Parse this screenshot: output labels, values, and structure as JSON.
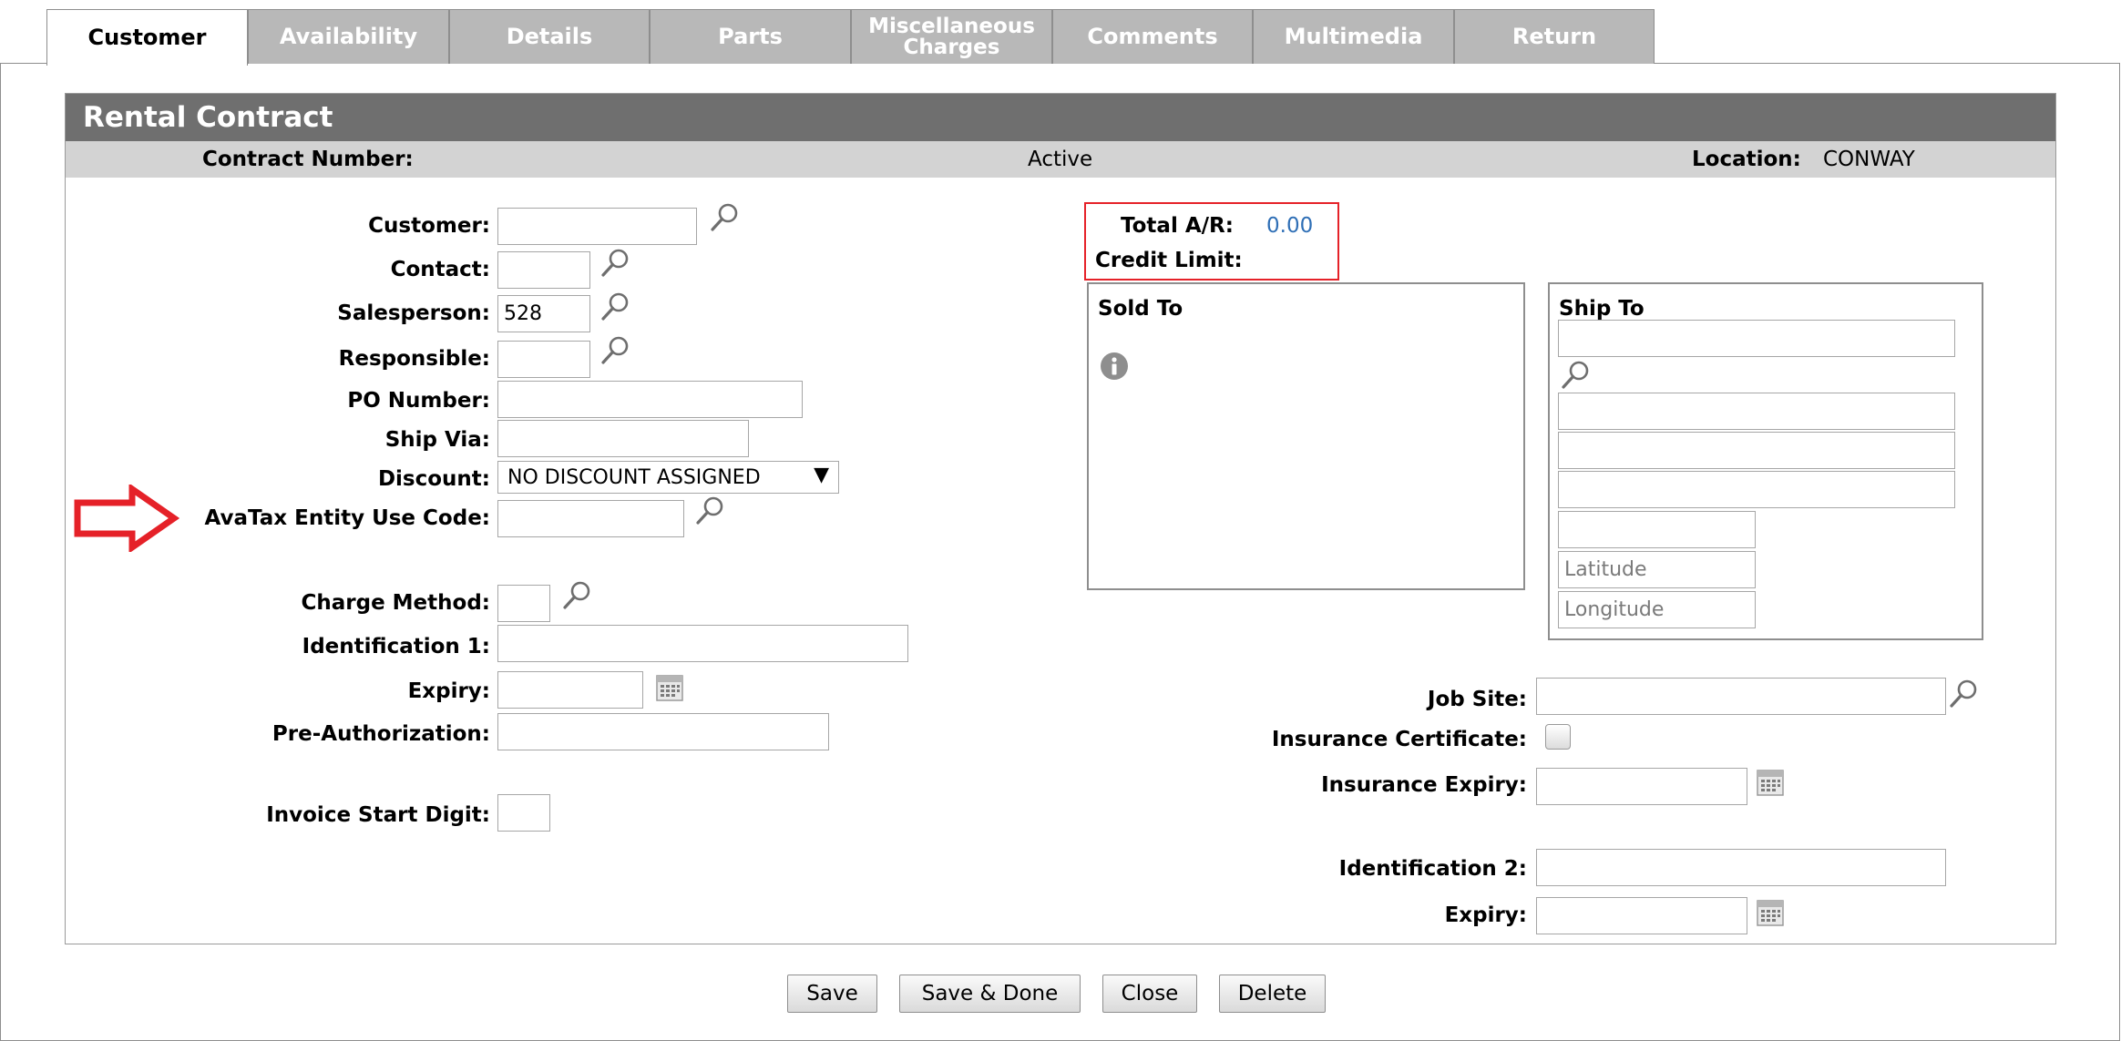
{
  "tabs": [
    {
      "label": "Customer"
    },
    {
      "label": "Availability"
    },
    {
      "label": "Details"
    },
    {
      "label": "Parts"
    },
    {
      "label_line1": "Miscellaneous",
      "label_line2": "Charges"
    },
    {
      "label": "Comments"
    },
    {
      "label": "Multimedia"
    },
    {
      "label": "Return"
    }
  ],
  "panel": {
    "title": "Rental Contract",
    "contract_number_label": "Contract Number:",
    "contract_number_value": "",
    "status": "Active",
    "location_label": "Location:",
    "location_value": "CONWAY"
  },
  "form": {
    "customer": {
      "label": "Customer:",
      "value": ""
    },
    "contact": {
      "label": "Contact:",
      "value": ""
    },
    "salesperson": {
      "label": "Salesperson:",
      "value": "528"
    },
    "responsible": {
      "label": "Responsible:",
      "value": ""
    },
    "po_number": {
      "label": "PO Number:",
      "value": ""
    },
    "ship_via": {
      "label": "Ship Via:",
      "value": ""
    },
    "discount": {
      "label": "Discount:",
      "value": "NO DISCOUNT ASSIGNED"
    },
    "avatax": {
      "label": "AvaTax Entity Use Code:",
      "value": ""
    },
    "charge_method": {
      "label": "Charge Method:",
      "value": ""
    },
    "identification1": {
      "label": "Identification 1:",
      "value": ""
    },
    "expiry1": {
      "label": "Expiry:",
      "value": ""
    },
    "pre_authorization": {
      "label": "Pre-Authorization:",
      "value": ""
    },
    "invoice_start_digit": {
      "label": "Invoice Start Digit:",
      "value": ""
    }
  },
  "credit": {
    "total_ar_label": "Total A/R:",
    "total_ar_value": "0.00",
    "credit_limit_label": "Credit Limit:",
    "credit_limit_value": ""
  },
  "sold_to": {
    "title": "Sold To"
  },
  "ship_to": {
    "title": "Ship To",
    "latitude_placeholder": "Latitude",
    "longitude_placeholder": "Longitude"
  },
  "right_form": {
    "job_site": {
      "label": "Job Site:",
      "value": ""
    },
    "insurance_certificate": {
      "label": "Insurance Certificate:",
      "checked": false
    },
    "insurance_expiry": {
      "label": "Insurance Expiry:",
      "value": ""
    },
    "identification2": {
      "label": "Identification 2:",
      "value": ""
    },
    "expiry2": {
      "label": "Expiry:",
      "value": ""
    }
  },
  "buttons": {
    "save": "Save",
    "save_done": "Save & Done",
    "close": "Close",
    "delete": "Delete"
  },
  "colors": {
    "header_bg": "#6f6f6f",
    "subheader_bg": "#d3d3d3",
    "tab_inactive": "#b8b8b8",
    "annotation_red": "#e52128",
    "link_blue": "#2f6fb6"
  },
  "icons": {
    "lookup": "magnifier-icon",
    "calendar": "calendar-icon",
    "info": "info-icon",
    "arrow": "red-arrow-annotation"
  }
}
